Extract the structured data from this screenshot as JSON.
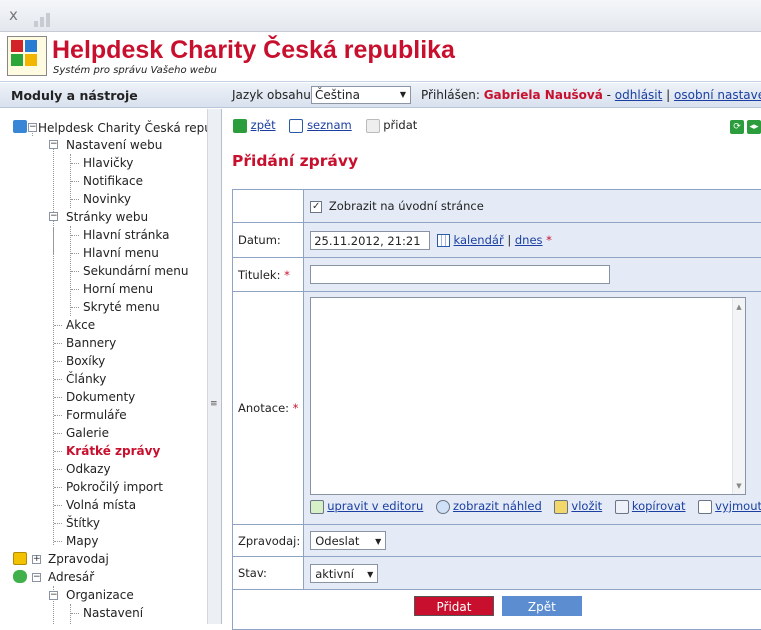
{
  "window": {
    "close_glyph": "x"
  },
  "header": {
    "title": "Helpdesk Charity Česká republika",
    "subtitle": "Systém pro správu Vašeho webu"
  },
  "subbar": {
    "modules_title": "Moduly a nástroje",
    "lang_label": "Jazyk obsahu:",
    "lang_value": "Čeština",
    "logged_label": "Přihlášen:",
    "user_name": "Gabriela Naušová",
    "sep1": "-",
    "logout": "odhlásit",
    "sep2": "|",
    "personal_settings": "osobní nastavení"
  },
  "tree": {
    "root": "Helpdesk Charity Česká republika",
    "nastaveni_webu": "Nastavení webu",
    "hlavicky": "Hlavičky",
    "notifikace": "Notifikace",
    "novinky": "Novinky",
    "stranky_webu": "Stránky webu",
    "hlavni_stranka": "Hlavní stránka",
    "hlavni_menu": "Hlavní menu",
    "sekundarni_menu": "Sekundární menu",
    "horni_menu": "Horní menu",
    "skryte_menu": "Skryté menu",
    "akce": "Akce",
    "bannery": "Bannery",
    "boxiky": "Boxíky",
    "clanky": "Články",
    "dokumenty": "Dokumenty",
    "formulare": "Formuláře",
    "galerie": "Galerie",
    "kratke_zpravy": "Krátké zprávy",
    "odkazy": "Odkazy",
    "pokrocily_import": "Pokročilý import",
    "volna_mista": "Volná místa",
    "stitky": "Štítky",
    "mapy": "Mapy",
    "zpravodaj": "Zpravodaj",
    "adresar": "Adresář",
    "organizace": "Organizace",
    "nastaveni": "Nastavení"
  },
  "toolbar": {
    "back": "zpět",
    "list": "seznam",
    "add": "přidat"
  },
  "page_title": "Přidání zprávy",
  "form": {
    "show_on_home_label": "Zobrazit na úvodní stránce",
    "show_on_home_checked": true,
    "date_label": "Datum:",
    "date_value": "25.11.2012, 21:21",
    "calendar_link": "kalendář",
    "date_sep": "|",
    "today_link": "dnes",
    "title_label": "Titulek:",
    "title_value": "",
    "annotation_label": "Anotace:",
    "annotation_value": "",
    "edit_in_editor": "upravit v editoru",
    "show_preview": "zobrazit náhled",
    "insert": "vložit",
    "copy": "kopírovat",
    "cut": "vyjmout",
    "newsletter_label": "Zpravodaj:",
    "newsletter_value": "Odeslat",
    "status_label": "Stav:",
    "status_value": "aktivní",
    "required_mark": "*"
  },
  "buttons": {
    "add": "Přidat",
    "back": "Zpět"
  },
  "colors": {
    "brand_red": "#c8102e",
    "form_bg": "#e4ebf6",
    "border_blue": "#8fa3c4",
    "link": "#1a3fa0"
  }
}
